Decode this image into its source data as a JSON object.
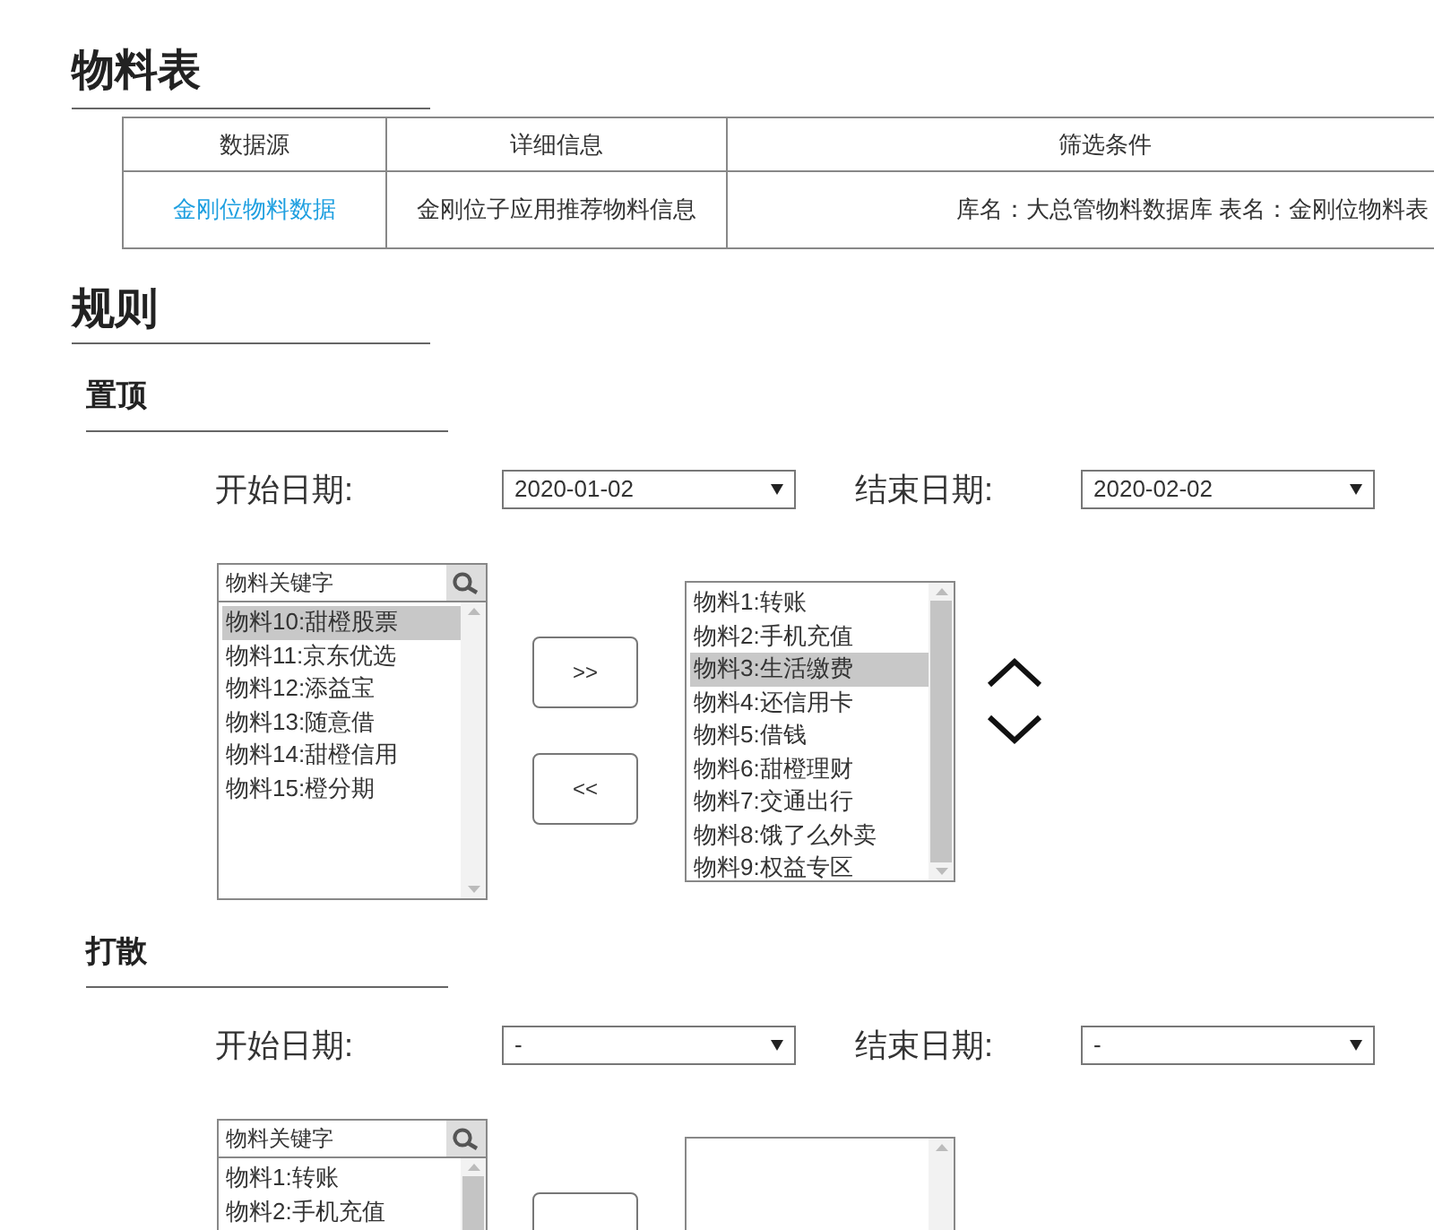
{
  "title": "物料表",
  "table": {
    "columns": [
      "数据源",
      "详细信息",
      "筛选条件"
    ],
    "rows": [
      [
        {
          "text": "金刚位物料数据",
          "kind": "link"
        },
        {
          "text": "金刚位子应用推荐物料信息",
          "kind": "text"
        },
        {
          "text": "库名：大总管物料数据库 表名：金刚位物料表",
          "kind": "text"
        }
      ]
    ]
  },
  "rules_title": "规则",
  "sections": [
    {
      "title": "置顶",
      "start_label": "开始日期:",
      "start_value": "2020-01-02",
      "end_label": "结束日期:",
      "end_value": "2020-02-02",
      "search_placeholder": "物料关键字",
      "available": {
        "scrollable": false,
        "items": [
          {
            "label": "物料10:甜橙股票",
            "selected": true
          },
          {
            "label": "物料11:京东优选",
            "selected": false
          },
          {
            "label": "物料12:添益宝",
            "selected": false
          },
          {
            "label": "物料13:随意借",
            "selected": false
          },
          {
            "label": "物料14:甜橙信用",
            "selected": false
          },
          {
            "label": "物料15:橙分期",
            "selected": false
          }
        ]
      },
      "move_right": ">>",
      "move_left": "<<",
      "chosen": {
        "scrollable": true,
        "items": [
          {
            "label": "物料1:转账",
            "selected": false
          },
          {
            "label": "物料2:手机充值",
            "selected": false
          },
          {
            "label": "物料3:生活缴费",
            "selected": true
          },
          {
            "label": "物料4:还信用卡",
            "selected": false
          },
          {
            "label": "物料5:借钱",
            "selected": false
          },
          {
            "label": "物料6:甜橙理财",
            "selected": false
          },
          {
            "label": "物料7:交通出行",
            "selected": false
          },
          {
            "label": "物料8:饿了么外卖",
            "selected": false
          },
          {
            "label": "物料9:权益专区",
            "selected": false
          }
        ]
      }
    },
    {
      "title": "打散",
      "start_label": "开始日期:",
      "start_value": "-",
      "end_label": "结束日期:",
      "end_value": "-",
      "search_placeholder": "物料关键字",
      "available": {
        "scrollable": true,
        "items": [
          {
            "label": "物料1:转账",
            "selected": false
          },
          {
            "label": "物料2:手机充值",
            "selected": false
          }
        ]
      },
      "chosen": {
        "scrollable": false
      }
    }
  ]
}
